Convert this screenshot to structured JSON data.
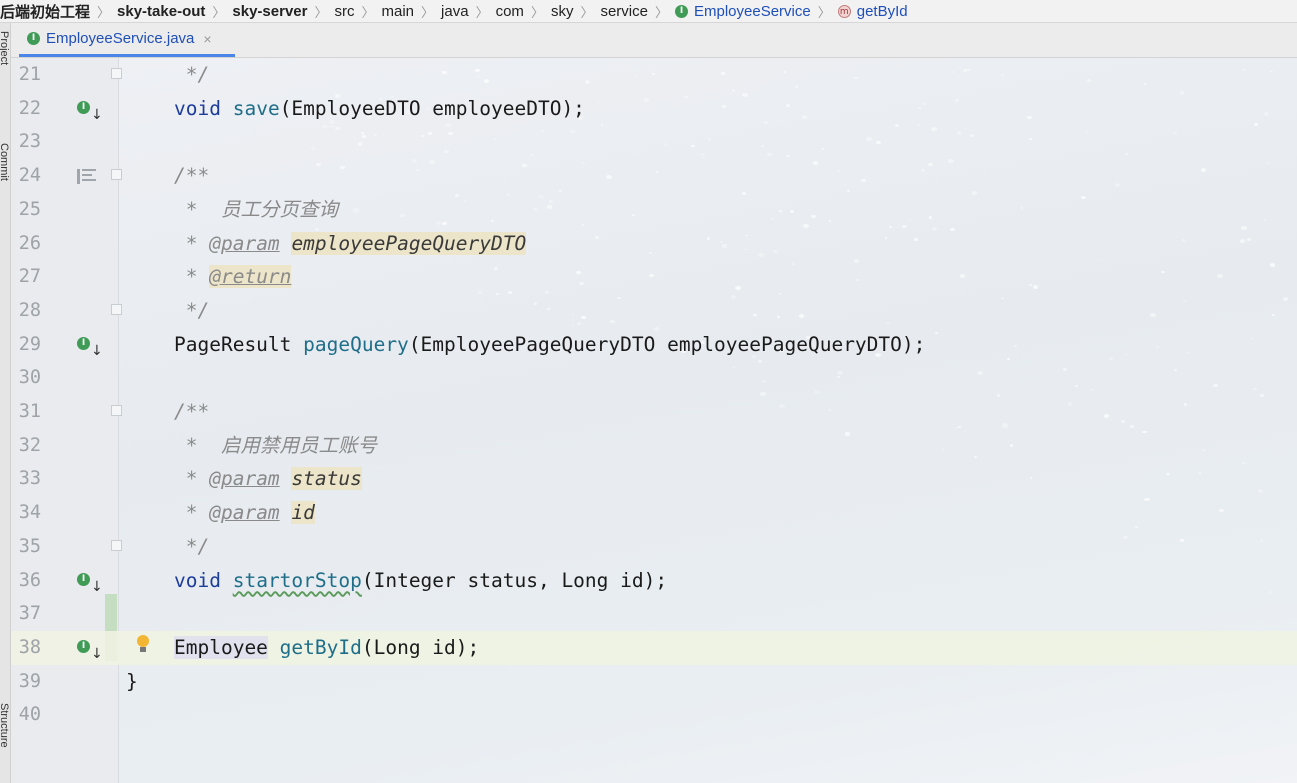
{
  "breadcrumb": {
    "items": [
      {
        "label": "后端初始工程",
        "style": "bold",
        "icon": ""
      },
      {
        "label": "sky-take-out",
        "style": "bold",
        "icon": ""
      },
      {
        "label": "sky-server",
        "style": "bold",
        "icon": ""
      },
      {
        "label": "src",
        "style": "plain",
        "icon": ""
      },
      {
        "label": "main",
        "style": "plain",
        "icon": ""
      },
      {
        "label": "java",
        "style": "plain",
        "icon": ""
      },
      {
        "label": "com",
        "style": "plain",
        "icon": ""
      },
      {
        "label": "sky",
        "style": "plain",
        "icon": ""
      },
      {
        "label": "service",
        "style": "plain",
        "icon": ""
      },
      {
        "label": "EmployeeService",
        "style": "blue",
        "icon": "interface-icon"
      },
      {
        "label": "getById",
        "style": "blue",
        "icon": "method-icon"
      }
    ]
  },
  "tool_strip": {
    "project_label": "Project",
    "commit_label": "Commit",
    "structure_label": "Structure"
  },
  "tab": {
    "label": "EmployeeService.java",
    "close": "×",
    "icon_letter": "I"
  },
  "gutter_icon_letter": "I",
  "gutter_arrow": "↓",
  "lines": [
    {
      "num": "21"
    },
    {
      "num": "22"
    },
    {
      "num": "23"
    },
    {
      "num": "24"
    },
    {
      "num": "25"
    },
    {
      "num": "26"
    },
    {
      "num": "27"
    },
    {
      "num": "28"
    },
    {
      "num": "29"
    },
    {
      "num": "30"
    },
    {
      "num": "31"
    },
    {
      "num": "32"
    },
    {
      "num": "33"
    },
    {
      "num": "34"
    },
    {
      "num": "35"
    },
    {
      "num": "36"
    },
    {
      "num": "37"
    },
    {
      "num": "38"
    },
    {
      "num": "39"
    },
    {
      "num": "40"
    }
  ],
  "code": {
    "l21_close": " */",
    "l22_kw": "void",
    "l22_fn": "save",
    "l22_rest": "(EmployeeDTO employeeDTO);",
    "l24_open": "/**",
    "l25_star": " *  ",
    "l25_text": "员工分页查询",
    "l26_star": " * ",
    "l26_tag": "@param",
    "l26_val": "employeePageQueryDTO",
    "l27_star": " * ",
    "l27_tag": "@return",
    "l28_close": " */",
    "l29_type": "PageResult ",
    "l29_fn": "pageQuery",
    "l29_rest": "(EmployeePageQueryDTO employeePageQueryDTO);",
    "l31_open": "/**",
    "l32_star": " *  ",
    "l32_text": "启用禁用员工账号",
    "l33_star": " * ",
    "l33_tag": "@param",
    "l33_val": "status",
    "l34_star": " * ",
    "l34_tag": "@param",
    "l34_val": "id",
    "l35_close": " */",
    "l36_kw": "void",
    "l36_fn": "startorStop",
    "l36_rest": "(Integer status, Long id);",
    "l38_type": "Employee",
    "l38_fn": "getById",
    "l38_rest": "(Long id);",
    "l39_brace": "}"
  }
}
